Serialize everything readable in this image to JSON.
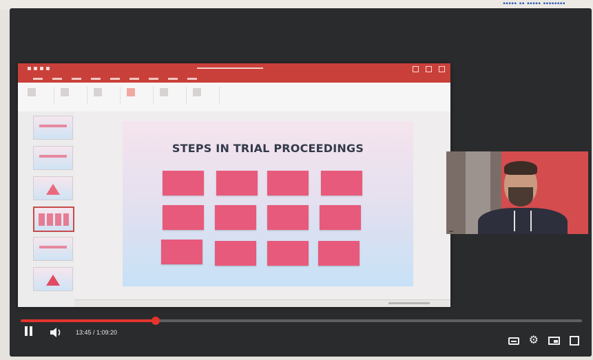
{
  "page": {
    "top_crumb": "▪▪▪▪▪ ▪▪ ▪▪▪▪▪ ▪▪▪▪▪▪▪▪"
  },
  "video": {
    "slide_title": "STEPS IN TRIAL PROCEEDINGS",
    "steps": [
      "",
      "",
      "",
      "",
      "",
      "",
      "",
      "",
      "",
      "",
      "",
      ""
    ],
    "webcam_name": "",
    "time_display": "13:45 / 1:09:20",
    "progress_fraction": 0.24,
    "accent_color": "#e5342d"
  },
  "controls": {
    "pause_icon": "pause-icon",
    "volume_icon": "volume-icon",
    "captions_icon": "captions-icon",
    "settings_icon": "gear-icon",
    "miniplayer_icon": "miniplayer-icon",
    "fullscreen_icon": "fullscreen-icon"
  }
}
